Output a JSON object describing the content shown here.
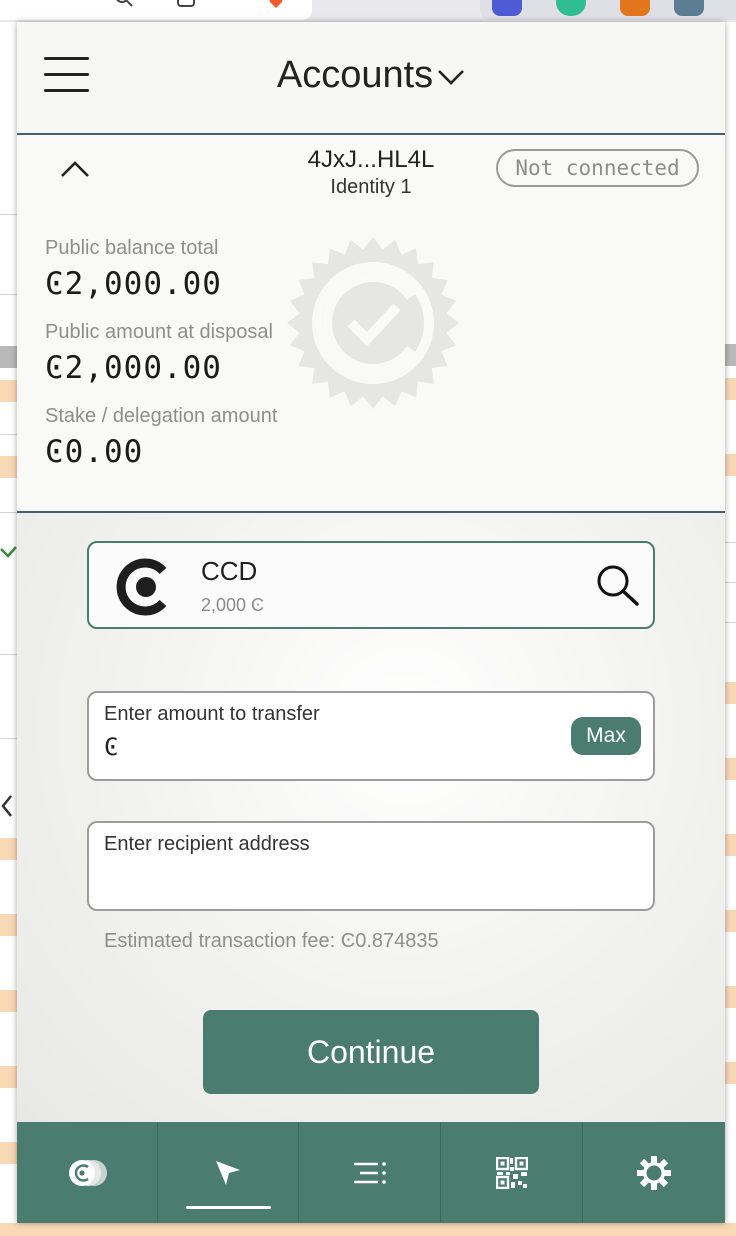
{
  "header": {
    "title": "Accounts"
  },
  "account": {
    "address": "4JxJ...HL4L",
    "identity": "Identity 1",
    "connection_status": "Not connected",
    "balances": [
      {
        "label": "Public balance total",
        "value": "Ͼ2,000.00"
      },
      {
        "label": "Public amount at disposal",
        "value": "Ͼ2,000.00"
      },
      {
        "label": "Stake / delegation amount",
        "value": "Ͼ0.00"
      }
    ]
  },
  "token": {
    "name": "CCD",
    "balance": "2,000 Ͼ"
  },
  "amount_field": {
    "label": "Enter amount to transfer",
    "prefix": "Ͼ",
    "value": "",
    "max_label": "Max"
  },
  "recipient_field": {
    "label": "Enter recipient address",
    "value": ""
  },
  "fee_text": "Estimated transaction fee: Ͼ0.874835",
  "continue_label": "Continue",
  "bottom_nav": {
    "items": [
      {
        "icon": "tokens-icon",
        "active": false
      },
      {
        "icon": "send-icon",
        "active": true
      },
      {
        "icon": "transaction-list-icon",
        "active": false
      },
      {
        "icon": "qr-code-icon",
        "active": false
      },
      {
        "icon": "settings-gear-icon",
        "active": false
      }
    ]
  },
  "colors": {
    "accent": "#4a7c6f",
    "divider": "#4a5d6e",
    "muted_text": "#8e8e8e"
  }
}
